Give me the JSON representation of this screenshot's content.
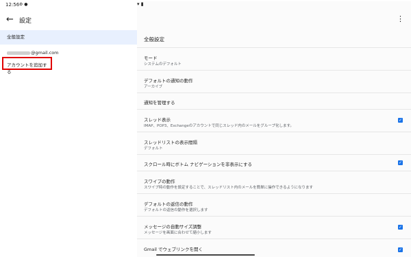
{
  "status": {
    "time": "12:56",
    "dots": "•••",
    "right": "▾ ▮"
  },
  "appbar": {
    "title": "設定"
  },
  "left": {
    "general": "全般設定",
    "email_suffix": "@gmail.com",
    "add_account": "アカウントを追加する"
  },
  "right": {
    "header": "全般設定",
    "rows": [
      {
        "title": "モード",
        "sub": "システムのデフォルト",
        "checked": false
      },
      {
        "title": "デフォルトの通知の動作",
        "sub": "アーカイブ",
        "checked": false
      },
      {
        "title": "通知を管理する",
        "sub": "",
        "checked": false
      },
      {
        "title": "スレッド表示",
        "sub": "IMAP、POP3、Exchangeのアカウントで同じスレッド内のメールをグループ化します。",
        "checked": true
      },
      {
        "title": "スレッドリストの表示間隔",
        "sub": "デフォルト",
        "checked": false
      },
      {
        "title": "スクロール時にボトム ナビゲーションを非表示にする",
        "sub": "",
        "checked": true
      },
      {
        "title": "スワイプの動作",
        "sub": "スワイプ時の動作を設定することで、スレッドリスト内のメールを簡単に操作できるようになります",
        "checked": false
      },
      {
        "title": "デフォルトの返信の動作",
        "sub": "デフォルトの返信の動作を選択します",
        "checked": false
      },
      {
        "title": "メッセージの自動サイズ調整",
        "sub": "メッセージを画面に合わせて縮小します",
        "checked": true
      },
      {
        "title": "Gmail でウェブリンクを開く",
        "sub": "",
        "checked": true
      }
    ]
  }
}
